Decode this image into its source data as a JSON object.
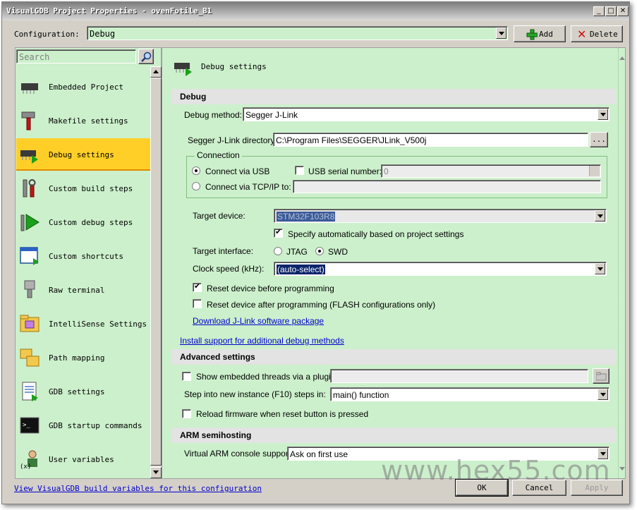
{
  "window": {
    "title": "VisualGDB Project Properties - ovenFotile_B1",
    "min_glyph": "_",
    "max_glyph": "□",
    "close_glyph": "✕"
  },
  "config": {
    "label": "Configuration:",
    "value": "Debug",
    "add_label": "Add",
    "delete_label": "Delete"
  },
  "search": {
    "placeholder": "Search"
  },
  "sidebar": {
    "items": [
      {
        "label": "Embedded Project",
        "icon": "chip-icon"
      },
      {
        "label": "Makefile settings",
        "icon": "hammer-icon"
      },
      {
        "label": "Debug settings",
        "icon": "debug-chip-icon"
      },
      {
        "label": "Custom build steps",
        "icon": "tools-icon"
      },
      {
        "label": "Custom debug steps",
        "icon": "play-tools-icon"
      },
      {
        "label": "Custom shortcuts",
        "icon": "window-shortcut-icon"
      },
      {
        "label": "Raw terminal",
        "icon": "serial-plug-icon"
      },
      {
        "label": "IntelliSense Settings",
        "icon": "intellisense-folder-icon"
      },
      {
        "label": "Path mapping",
        "icon": "folders-icon"
      },
      {
        "label": "GDB settings",
        "icon": "document-icon"
      },
      {
        "label": "GDB startup commands",
        "icon": "terminal-icon"
      },
      {
        "label": "User variables",
        "icon": "user-variables-icon"
      }
    ],
    "selected_index": 2
  },
  "panel": {
    "title": "Debug settings",
    "debug_section": "Debug",
    "debug_method_label": "Debug method:",
    "debug_method_value": "Segger J-Link",
    "jlink_dir_label": "Segger J-Link directory:",
    "jlink_dir_value": "C:\\Program Files\\SEGGER\\JLink_V500j",
    "browse_label": "...",
    "connection_label": "Connection",
    "via_usb_label": "Connect via USB",
    "usb_serial_label": "USB serial number:",
    "usb_serial_value": "0",
    "via_tcp_label": "Connect via TCP/IP to:",
    "target_device_label": "Target device:",
    "target_device_value": "STM32F103R8",
    "auto_specify_label": "Specify automatically based on project settings",
    "target_interface_label": "Target interface:",
    "jtag_label": "JTAG",
    "swd_label": "SWD",
    "clock_label": "Clock speed (kHz):",
    "clock_value": "(auto-select)",
    "reset_before_label": "Reset device before programming",
    "reset_after_label": "Reset device after programming (FLASH configurations only)",
    "download_link": "Download J-Link software package",
    "install_link": "Install support for additional debug methods",
    "advanced_section": "Advanced settings",
    "show_threads_label": "Show embedded threads via a plugin:",
    "step_into_label": "Step into new instance (F10) steps in:",
    "step_into_value": "main() function",
    "reload_fw_label": "Reload firmware when reset button is pressed",
    "arm_section": "ARM semihosting",
    "arm_console_label": "Virtual ARM console support:",
    "arm_console_value": "Ask on first use"
  },
  "footer": {
    "view_link": "View VisualGDB build variables for this configuration",
    "ok_label": "OK",
    "cancel_label": "Cancel",
    "apply_label": "Apply"
  },
  "watermark": "www.hex55.com",
  "colors": {
    "panel_bg": "#ccf0cc",
    "selected_item": "#ffcf28",
    "link": "#0000cc"
  }
}
